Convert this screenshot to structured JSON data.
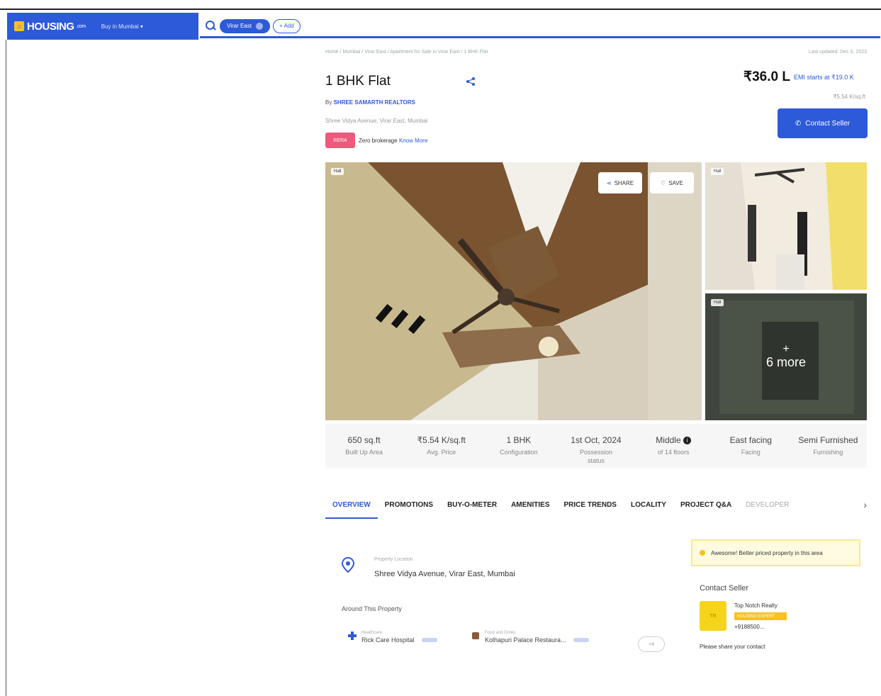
{
  "header": {
    "logo_text": "HOUSING",
    "logo_sub": ".com",
    "city": "Buy in Mumbai",
    "search_chip": "Virar East",
    "add_label": "+ Add"
  },
  "listing": {
    "breadcrumb": "Home / Mumbai / Virar East / Apartment for Sale in Virar East / 1 BHK Flat",
    "last_updated": "Last updated: Dec 6, 2023",
    "title": "1 BHK Flat",
    "by_prefix": "By",
    "builder": "SHREE SAMARTH REALTORS",
    "address": "Shree Vidya Avenue, Virar East, Mumbai",
    "rera": "RERA",
    "zero_brokerage": "Zero brokerage",
    "know_more": "Know More",
    "price": "₹36.0 L",
    "emi": "EMI starts at ₹19.0 K",
    "price_per_sqft": "₹5.54 K/sq.ft",
    "contact_button": "Contact Seller"
  },
  "gallery": {
    "main_tag": "Hall",
    "side1_tag": "Hall",
    "side2_tag": "Hall",
    "share_label": "SHARE",
    "save_label": "SAVE",
    "more_plus": "+",
    "more_text": "6 more"
  },
  "stats": [
    {
      "value": "650 sq.ft",
      "label": "Built Up Area"
    },
    {
      "value": "₹5.54 K/sq.ft",
      "label": "Avg. Price"
    },
    {
      "value": "1 BHK",
      "label": "Configuration"
    },
    {
      "value": "1st Oct, 2024",
      "label": "Possession status"
    },
    {
      "value": "Middle",
      "label": "of 14 floors"
    },
    {
      "value": "East facing",
      "label": "Facing"
    },
    {
      "value": "Semi Furnished",
      "label": "Furnishing"
    }
  ],
  "tabs": [
    "OVERVIEW",
    "PROMOTIONS",
    "BUY-O-METER",
    "AMENITIES",
    "PRICE TRENDS",
    "LOCALITY",
    "PROJECT Q&A",
    "DEVELOPER"
  ],
  "tab_next": "›",
  "overview": {
    "location_label": "Property Location",
    "location_value": "Shree Vidya Avenue, Virar East, Mumbai",
    "around_title": "Around This Property",
    "nearby": [
      {
        "category": "Healthcare",
        "name": "Rick Care Hospital"
      },
      {
        "category": "Food and Drinks",
        "name": "Kolhapuri Palace Restaura..."
      }
    ],
    "nearby_more": "+4"
  },
  "sidebar": {
    "promo_text": "Awesome! Better priced property in this area",
    "contact_title": "Contact Seller",
    "agent_avatar_text": "TR",
    "agent_name": "Top Notch Realty",
    "agent_badge": "HOUSING EXPERT",
    "agent_phone": "+9188500...",
    "share_number": "Please share your contact"
  },
  "colors": {
    "brand_blue": "#2d5ad8",
    "rera_pink": "#ec5a7c",
    "highlight_yellow": "#f6c21b"
  }
}
